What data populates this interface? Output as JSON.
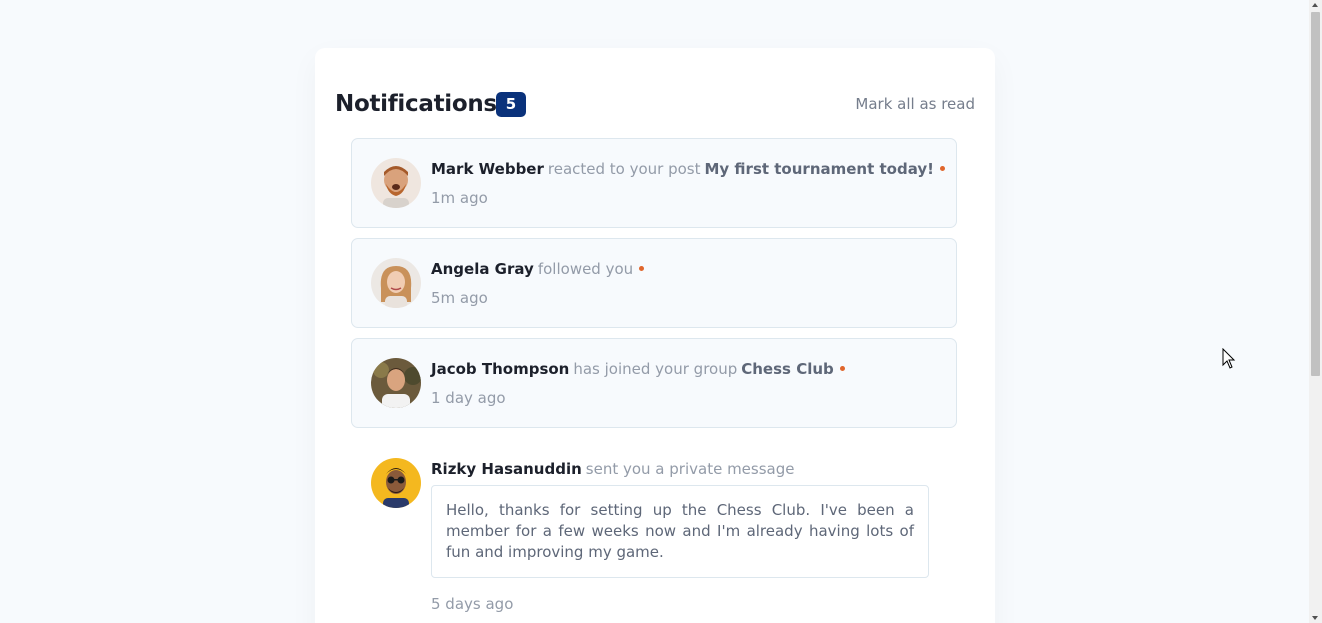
{
  "header": {
    "title": "Notifications",
    "unread_count": "5",
    "mark_all_label": "Mark all as read"
  },
  "notifications": [
    {
      "name": "Mark Webber",
      "action": "reacted to your post",
      "target": "My first tournament today!",
      "time": "1m ago",
      "unread": true,
      "avatar_icon": "avatar-mark-webber"
    },
    {
      "name": "Angela Gray",
      "action": "followed you",
      "target": "",
      "time": "5m ago",
      "unread": true,
      "avatar_icon": "avatar-angela-gray"
    },
    {
      "name": "Jacob Thompson",
      "action": "has joined your group",
      "target": "Chess Club",
      "time": "1 day ago",
      "unread": true,
      "avatar_icon": "avatar-jacob-thompson"
    },
    {
      "name": "Rizky Hasanuddin",
      "action": "sent you a private message",
      "message": "Hello, thanks for setting up the Chess Club. I've been a member for a few weeks now and I'm already having lots of fun and improving my game.",
      "time": "5 days ago",
      "unread": false,
      "avatar_icon": "avatar-rizky-hasanuddin"
    }
  ],
  "colors": {
    "background": "#f7fafd",
    "badge": "#0a327b",
    "unread_dot": "#e0662c",
    "heading": "#1c202b",
    "muted": "#939ba8"
  }
}
